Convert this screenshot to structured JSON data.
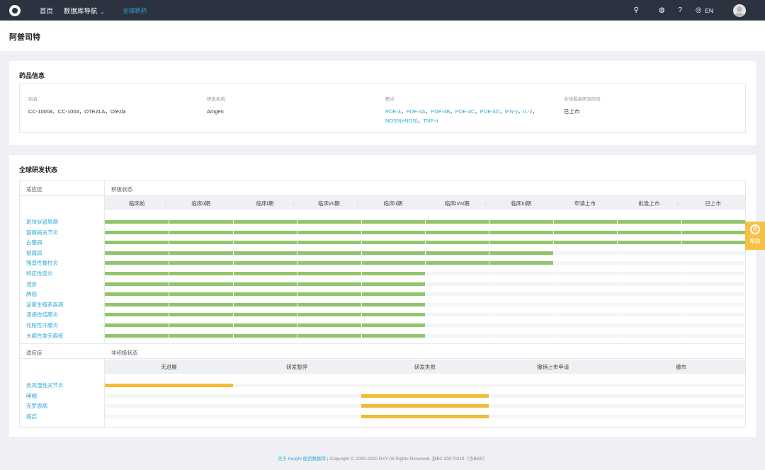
{
  "nav": {
    "home": "首页",
    "db_nav": "数据库导航",
    "active": "全球新药",
    "lang": "EN"
  },
  "page": {
    "title": "阿普司特"
  },
  "drug_info": {
    "section_title": "药品信息",
    "alias_label": "别名",
    "alias_value": "CC-10004，CC-1004，OTEZLA，Otezla",
    "org_label": "研发机构",
    "org_value": "Amgen",
    "target_label": "靶点",
    "targets": [
      "PDE-4",
      "PDE-4A",
      "PDE-4B",
      "PDE-4C",
      "PDE-4D",
      "IFN-γ",
      "IL-2",
      "NOS3(eNOS)",
      "TNF-α"
    ],
    "stage_label": "全球最高研发阶段",
    "stage_value": "已上市"
  },
  "global_status": {
    "section_title": "全球研发状态",
    "indication_header": "适应症",
    "active_header": "积极状态",
    "inactive_header": "非积极状态",
    "phases": [
      "临床前",
      "临床0期",
      "临床I期",
      "临床I/II期",
      "临床II期",
      "临床II/III期",
      "临床III期",
      "申请上市",
      "批准上市",
      "已上市"
    ],
    "active_rows": [
      {
        "name": "斑块状银屑病",
        "reached": 10
      },
      {
        "name": "银屑病关节炎",
        "reached": 10
      },
      {
        "name": "白塞病",
        "reached": 10
      },
      {
        "name": "银屑病",
        "reached": 7
      },
      {
        "name": "强直性脊柱炎",
        "reached": 7
      },
      {
        "name": "特应性皮炎",
        "reached": 5
      },
      {
        "name": "湿疹",
        "reached": 5
      },
      {
        "name": "肺癌",
        "reached": 5
      },
      {
        "name": "泌尿生殖系疾病",
        "reached": 5
      },
      {
        "name": "溃疡性结肠炎",
        "reached": 5
      },
      {
        "name": "化脓性汗腺炎",
        "reached": 5
      },
      {
        "name": "大疱性类天疱疮",
        "reached": 5
      }
    ],
    "inactive_statuses": [
      "无进展",
      "研发暂停",
      "研发失败",
      "撤销上市申请",
      "撤市"
    ],
    "inactive_rows": [
      {
        "name": "类风湿性关节炎",
        "status_index": 0
      },
      {
        "name": "哮喘",
        "status_index": 2
      },
      {
        "name": "克罗恩病",
        "status_index": 2
      },
      {
        "name": "癌症",
        "status_index": 2
      }
    ]
  },
  "footer": {
    "link": "关于 Insight 医药数据库",
    "text": "| Copyright © 2000-2020 DXY All Rights Reserved. 浙B2-20070219（含BBS）"
  },
  "help": {
    "label": "帮助"
  },
  "colors": {
    "active_bar": "#8fc56b",
    "inactive_bar": "#f3bb35",
    "link": "#2ea7d6",
    "nav_bg": "#2c3240"
  },
  "icons": [
    "logo-icon",
    "search-icon",
    "bulb-icon",
    "help-circle-icon",
    "globe-icon",
    "avatar-icon",
    "help-float-icon"
  ]
}
